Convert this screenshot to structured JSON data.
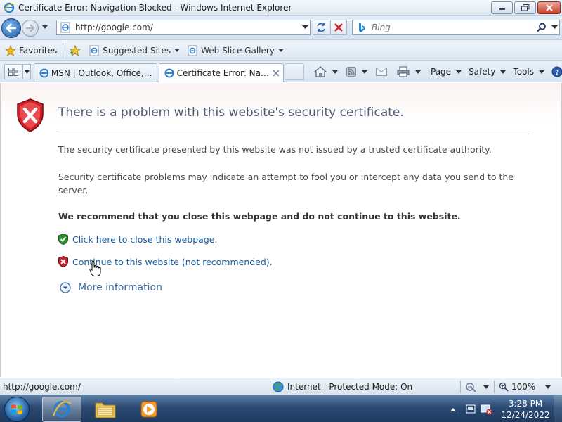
{
  "window": {
    "title": "Certificate Error: Navigation Blocked - Windows Internet Explorer",
    "app_icon": "ie-icon"
  },
  "navigation": {
    "address": "http://google.com/",
    "search_placeholder": "Bing"
  },
  "favorites_bar": {
    "favorites_label": "Favorites",
    "items": [
      {
        "label": "Suggested Sites",
        "icon": "ie-page-icon"
      },
      {
        "label": "Web Slice Gallery",
        "icon": "ie-page-icon"
      }
    ]
  },
  "tabs": [
    {
      "label": "MSN | Outlook, Office, Sky...",
      "active": false
    },
    {
      "label": "Certificate Error: Navig...",
      "active": true
    }
  ],
  "command_bar": {
    "page_label": "Page",
    "safety_label": "Safety",
    "tools_label": "Tools"
  },
  "content": {
    "heading": "There is a problem with this website's security certificate.",
    "paragraph1": "The security certificate presented by this website was not issued by a trusted certificate authority.",
    "paragraph2": "Security certificate problems may indicate an attempt to fool you or intercept any data you send to the server.",
    "recommendation": "We recommend that you close this webpage and do not continue to this website.",
    "close_link": "Click here to close this webpage.",
    "continue_link": "Continue to this website (not recommended).",
    "more_info": "More information"
  },
  "statusbar": {
    "url": "http://google.com/",
    "zone": "Internet | Protected Mode: On",
    "zoom": "100%"
  },
  "taskbar": {
    "time": "3:28 PM",
    "date": "12/24/2022"
  },
  "colors": {
    "link": "#1a5ca0",
    "heading": "#4e5b73",
    "error_red": "#c8202a",
    "ok_green": "#2f8f2f"
  }
}
